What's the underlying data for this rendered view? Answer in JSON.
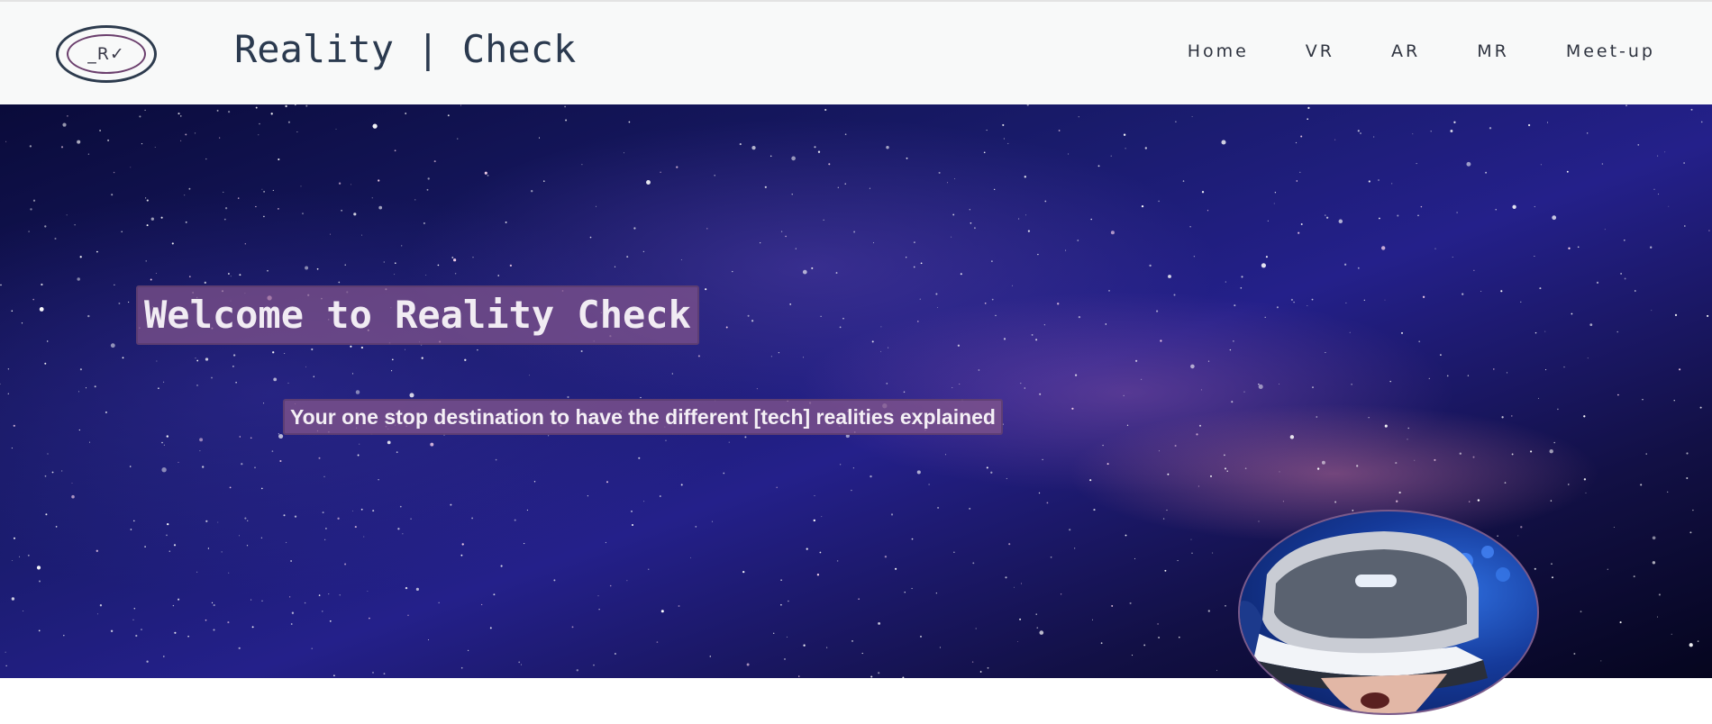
{
  "header": {
    "logo_text": "_R✓",
    "site_title": "Reality | Check",
    "nav": [
      "Home",
      "VR",
      "AR",
      "MR",
      "Meet-up"
    ]
  },
  "hero": {
    "title": "Welcome to Reality Check",
    "subtitle": "Your one stop destination to have the different [tech] realities explained"
  },
  "colors": {
    "header_bg": "#f8f9f9",
    "title_text": "#2b3a4f",
    "hero_label_bg": "#82558c",
    "sky_deep": "#0a0b3a"
  },
  "icons": {
    "logo": "reality-check-logo-icon",
    "hero_image": "vr-headset-photo"
  }
}
